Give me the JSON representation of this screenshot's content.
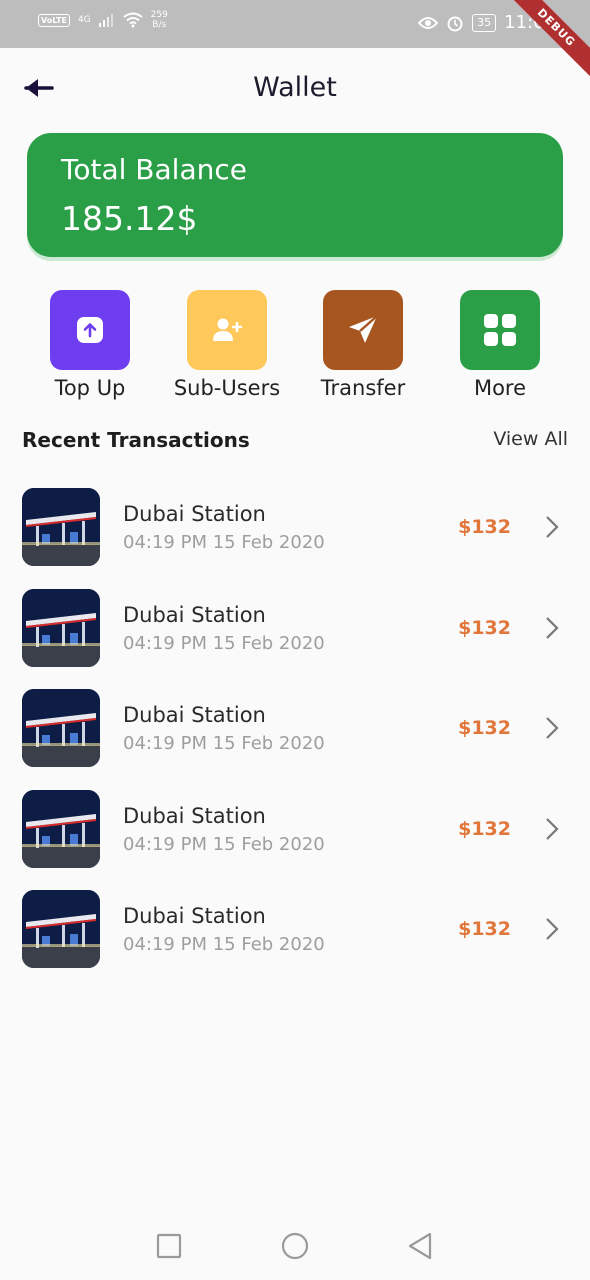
{
  "status_bar": {
    "volte": "VoLTE",
    "network": "4G",
    "speed_value": "259",
    "speed_unit": "B/s",
    "battery": "35",
    "time": "11:00",
    "debug_banner": "DEBUG"
  },
  "header": {
    "title": "Wallet",
    "back_icon": "arrow-left-icon"
  },
  "balance": {
    "label": "Total Balance",
    "amount": "185.12$",
    "color": "#2b9e48"
  },
  "actions": [
    {
      "label": "Top Up",
      "icon": "arrow-up-circle-icon",
      "color": "#6f3df0"
    },
    {
      "label": "Sub-Users",
      "icon": "add-user-icon",
      "color": "#ffc85a"
    },
    {
      "label": "Transfer",
      "icon": "send-icon",
      "color": "#a8561f"
    },
    {
      "label": "More",
      "icon": "grid-icon",
      "color": "#2b9e48"
    }
  ],
  "recent": {
    "title": "Recent Transactions",
    "view_all": "View All",
    "items": [
      {
        "name": "Dubai Station",
        "date": "04:19 PM 15 Feb 2020",
        "amount": "$132"
      },
      {
        "name": "Dubai Station",
        "date": "04:19 PM 15 Feb 2020",
        "amount": "$132"
      },
      {
        "name": "Dubai Station",
        "date": "04:19 PM 15 Feb 2020",
        "amount": "$132"
      },
      {
        "name": "Dubai Station",
        "date": "04:19 PM 15 Feb 2020",
        "amount": "$132"
      },
      {
        "name": "Dubai Station",
        "date": "04:19 PM 15 Feb 2020",
        "amount": "$132"
      }
    ]
  },
  "amount_color": "#e0763a",
  "nav": {
    "buttons": [
      "recent-apps-icon",
      "home-icon",
      "back-triangle-icon"
    ]
  }
}
